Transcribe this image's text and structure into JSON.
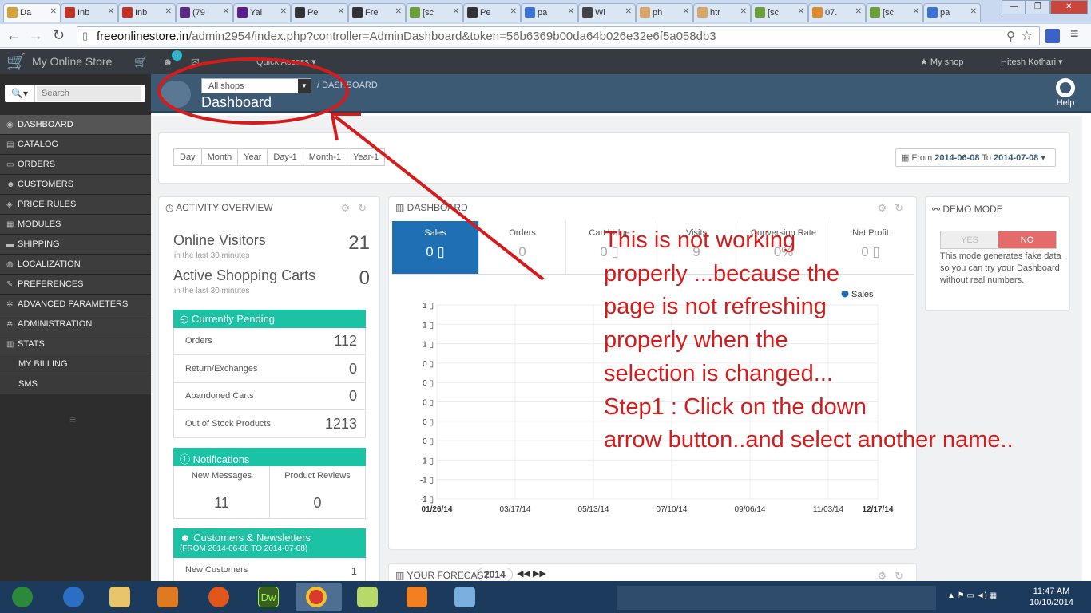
{
  "browser": {
    "tabs": [
      {
        "title": "Da",
        "color": "#d4a43a"
      },
      {
        "title": "Inb",
        "color": "#c23321"
      },
      {
        "title": "Inb",
        "color": "#c23321"
      },
      {
        "title": "(79",
        "color": "#5b2a86"
      },
      {
        "title": "Yal",
        "color": "#5f1c8f"
      },
      {
        "title": "Pe",
        "color": "#333333"
      },
      {
        "title": "Fre",
        "color": "#333333"
      },
      {
        "title": "[sc",
        "color": "#6a9f3a"
      },
      {
        "title": "Pe",
        "color": "#333333"
      },
      {
        "title": "pa",
        "color": "#3b73d6"
      },
      {
        "title": "Wl",
        "color": "#444444"
      },
      {
        "title": "ph",
        "color": "#d9a66a"
      },
      {
        "title": "htr",
        "color": "#d9a66a"
      },
      {
        "title": "[sc",
        "color": "#6a9f3a"
      },
      {
        "title": "07.",
        "color": "#e08b2b"
      },
      {
        "title": "[sc",
        "color": "#6a9f3a"
      },
      {
        "title": "pa",
        "color": "#3b73d6"
      }
    ],
    "url_domain": "freeonlinestore.in",
    "url_path": "/admin2954/index.php?controller=AdminDashboard&token=56b6369b00da64b026e32e6f5a058db3"
  },
  "header": {
    "brand": "My Online Store",
    "notification_count": "1",
    "quick_access": "Quick Access ▾",
    "my_shop": "★ My shop",
    "user": "Hitesh Kothari ▾"
  },
  "sidebar": {
    "search_placeholder": "Search",
    "items": [
      {
        "label": "DASHBOARD",
        "icon": "◉"
      },
      {
        "label": "CATALOG",
        "icon": "▤"
      },
      {
        "label": "ORDERS",
        "icon": "▭"
      },
      {
        "label": "CUSTOMERS",
        "icon": "☻"
      },
      {
        "label": "PRICE RULES",
        "icon": "◈"
      },
      {
        "label": "MODULES",
        "icon": "▦"
      },
      {
        "label": "SHIPPING",
        "icon": "▬"
      },
      {
        "label": "LOCALIZATION",
        "icon": "◍"
      },
      {
        "label": "PREFERENCES",
        "icon": "✎"
      },
      {
        "label": "ADVANCED PARAMETERS",
        "icon": "✲"
      },
      {
        "label": "ADMINISTRATION",
        "icon": "✲"
      },
      {
        "label": "STATS",
        "icon": "▥"
      },
      {
        "label": "MY BILLING",
        "icon": ""
      },
      {
        "label": "SMS",
        "icon": ""
      }
    ]
  },
  "pagehead": {
    "shop_select": "All shops",
    "breadcrumb": "/ DASHBOARD",
    "title": "Dashboard",
    "help": "Help"
  },
  "period": {
    "buttons": [
      "Day",
      "Month",
      "Year",
      "Day-1",
      "Month-1",
      "Year-1"
    ],
    "date_from_label": "From",
    "date_from": "2014-06-08",
    "date_to_label": "To",
    "date_to": "2014-07-08"
  },
  "activity": {
    "title": "ACTIVITY OVERVIEW",
    "online_visitors_label": "Online Visitors",
    "online_visitors_sub": "in the last 30 minutes",
    "online_visitors": "21",
    "active_carts_label": "Active Shopping Carts",
    "active_carts_sub": "in the last 30 minutes",
    "active_carts": "0",
    "pending_title": "Currently Pending",
    "pending": [
      {
        "label": "Orders",
        "value": "112"
      },
      {
        "label": "Return/Exchanges",
        "value": "0"
      },
      {
        "label": "Abandoned Carts",
        "value": "0"
      },
      {
        "label": "Out of Stock Products",
        "value": "1213"
      }
    ],
    "notifications_title": "Notifications",
    "notif_messages_label": "New Messages",
    "notif_messages": "11",
    "notif_reviews_label": "Product Reviews",
    "notif_reviews": "0",
    "customers_title": "Customers & Newsletters",
    "customers_range": "(FROM 2014-06-08 TO 2014-07-08)",
    "new_customers_label": "New Customers",
    "new_customers": "1"
  },
  "dashboard": {
    "title": "DASHBOARD",
    "kpis": [
      {
        "label": "Sales",
        "value": "0 ▯"
      },
      {
        "label": "Orders",
        "value": "0"
      },
      {
        "label": "Cart Value",
        "value": "0 ▯"
      },
      {
        "label": "Visits",
        "value": "9"
      },
      {
        "label": "Conversion Rate",
        "value": "0%"
      },
      {
        "label": "Net Profit",
        "value": "0 ▯"
      }
    ],
    "legend": "Sales",
    "y_ticks": [
      "1 ▯",
      "1 ▯",
      "1 ▯",
      "0 ▯",
      "0 ▯",
      "0 ▯",
      "0 ▯",
      "0 ▯",
      "-1 ▯",
      "-1 ▯",
      "-1 ▯"
    ],
    "x_ticks": [
      "01/26/14",
      "03/17/14",
      "05/13/14",
      "07/10/14",
      "09/06/14",
      "11/03/14",
      "12/17/14"
    ]
  },
  "forecast": {
    "title": "YOUR FORECAST",
    "year": "2014"
  },
  "demo": {
    "title": "DEMO MODE",
    "yes": "YES",
    "no": "NO",
    "text": "This mode generates fake data so you can try your Dashboard without real numbers."
  },
  "annotation": {
    "lines": [
      "This is not working",
      "properly ...because the",
      "page is not refreshing",
      "properly when the",
      "selection is changed...",
      "Step1 : Click on the down",
      "arrow button..and select another name.."
    ],
    "color": "#d41c1c"
  },
  "taskbar": {
    "time": "11:47 AM",
    "date": "10/10/2014"
  }
}
